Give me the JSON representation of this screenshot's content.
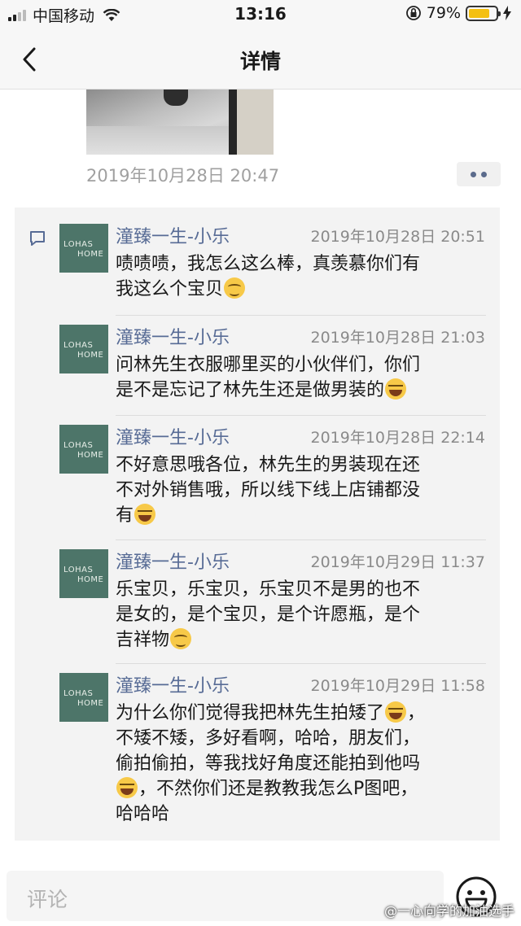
{
  "status_bar": {
    "carrier": "中国移动",
    "time": "13:16",
    "battery": "79%",
    "battery_level": 0.79
  },
  "nav": {
    "title": "详情",
    "back_icon": "chevron-left-icon"
  },
  "post": {
    "time": "2019年10月28日 20:47"
  },
  "comments": [
    {
      "name": "潼臻一生-小乐",
      "time": "2019年10月28日 20:51",
      "lines": [
        "啧啧啧，我怎么这么棒，真羡慕你们有",
        "我这么个宝贝"
      ],
      "emoji_line": 1,
      "emoji": "face1"
    },
    {
      "name": "潼臻一生-小乐",
      "time": "2019年10月28日 21:03",
      "lines": [
        "问林先生衣服哪里买的小伙伴们，你们",
        "是不是忘记了林先生还是做男装的"
      ],
      "emoji_line": 1,
      "emoji": "face2"
    },
    {
      "name": "潼臻一生-小乐",
      "time": "2019年10月28日 22:14",
      "lines": [
        "不好意思哦各位，林先生的男装现在还",
        "不对外销售哦，所以线下线上店铺都没",
        "有"
      ],
      "emoji_line": 2,
      "emoji": "face2"
    },
    {
      "name": "潼臻一生-小乐",
      "time": "2019年10月29日 11:37",
      "lines": [
        "乐宝贝，乐宝贝，乐宝贝不是男的也不",
        "是女的，是个宝贝，是个许愿瓶，是个",
        "吉祥物"
      ],
      "emoji_line": 2,
      "emoji": "face1"
    },
    {
      "name": "潼臻一生-小乐",
      "time": "2019年10月29日 11:58",
      "lines": [
        "为什么你们觉得我把林先生拍矮了",
        "不矮不矮，多好看啊，哈哈，朋友们，",
        "偷拍偷拍，等我找好角度还能拍到他吗",
        "，不然你们还是教教我怎么P图吧，",
        "哈哈哈"
      ],
      "emoji_line": 0,
      "emoji": "face2",
      "emoji2_line": 3,
      "emoji2_prefix": true
    }
  ],
  "avatar": {
    "line1": "LOHAS",
    "line2": "HOME",
    "color": "#4d7569"
  },
  "comment_input": {
    "placeholder": "评论"
  },
  "watermark": "@一心向学的加油选手",
  "colors": {
    "name": "#576b95",
    "time": "#8a8a8a",
    "panel": "#f3f3f3"
  }
}
